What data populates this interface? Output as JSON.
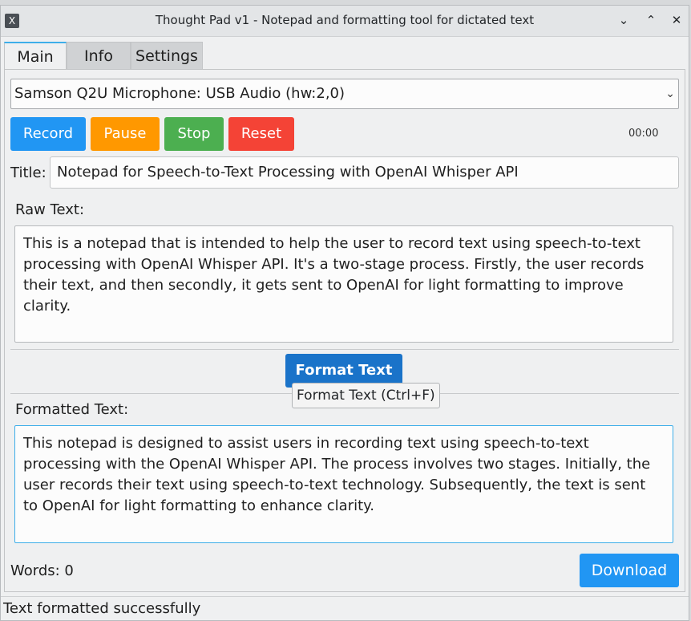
{
  "window": {
    "title": "Thought Pad v1 - Notepad and formatting tool for dictated text",
    "app_icon": "X",
    "controls": {
      "minimize": "⌄",
      "maximize": "⌃",
      "close": "✕"
    }
  },
  "tabs": [
    {
      "label": "Main",
      "active": true
    },
    {
      "label": "Info",
      "active": false
    },
    {
      "label": "Settings",
      "active": false
    }
  ],
  "main": {
    "device_select": {
      "value": "Samson Q2U Microphone: USB Audio (hw:2,0)"
    },
    "buttons": {
      "record": "Record",
      "pause": "Pause",
      "stop": "Stop",
      "reset": "Reset",
      "format": "Format Text",
      "download": "Download"
    },
    "timer": "00:00",
    "title_label": "Title:",
    "title_value": "Notepad for Speech-to-Text Processing with OpenAI Whisper API",
    "raw_label": "Raw Text:",
    "raw_text": "This is a notepad that is intended to help the user to record text using speech-to-text processing with OpenAI Whisper API. It's a two-stage process. Firstly, the user records their text, and then secondly, it gets sent to OpenAI for light formatting to improve clarity.",
    "tooltip": "Format Text (Ctrl+F)",
    "formatted_label": "Formatted Text:",
    "formatted_text": "This notepad is designed to assist users in recording text using speech-to-text processing with the OpenAI Whisper API. The process involves two stages. Initially, the user records their text using speech-to-text technology. Subsequently, the text is sent to OpenAI for light formatting to enhance clarity.",
    "word_count": "Words: 0"
  },
  "status": "Text formatted successfully",
  "colors": {
    "record": "#2196f3",
    "pause": "#ff9800",
    "stop": "#4caf50",
    "reset": "#f44336",
    "format": "#1a73c9",
    "download": "#2196f3",
    "accent": "#3daee9"
  }
}
